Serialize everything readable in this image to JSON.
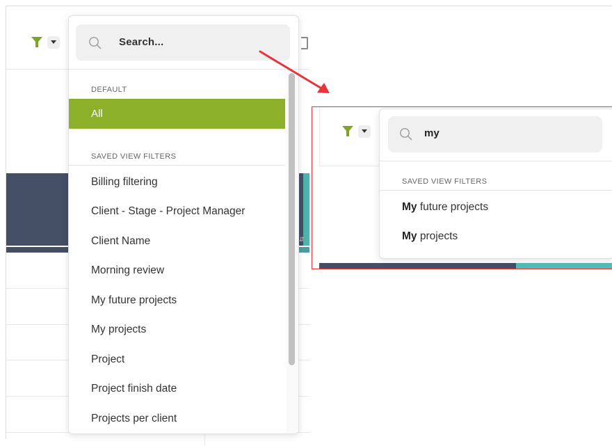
{
  "left": {
    "search": {
      "placeholder": "Search..."
    },
    "sections": {
      "default_label": "DEFAULT",
      "saved_label": "SAVED VIEW FILTERS"
    },
    "default_items": [
      "All"
    ],
    "saved_items": [
      "Billing filtering",
      "Client - Stage - Project Manager",
      "Client Name",
      "Morning review",
      "My future projects",
      "My projects",
      "Project",
      "Project finish date",
      "Projects per client"
    ]
  },
  "right": {
    "search": {
      "value": "my"
    },
    "sections": {
      "saved_label": "SAVED VIEW FILTERS"
    },
    "results": [
      {
        "match": "My",
        "rest": " future projects"
      },
      {
        "match": "My",
        "rest": " projects"
      }
    ]
  },
  "colors": {
    "filter_icon": "#7ba428",
    "selected_item_bg": "#8db02a",
    "header_dark": "#444f66",
    "header_teal": "#52bdb5",
    "arrow": "#e8343a",
    "highlight_border": "#e8343a"
  },
  "icons": [
    "filter-funnel-icon",
    "caret-down-icon",
    "search-icon",
    "arrow-icon"
  ]
}
